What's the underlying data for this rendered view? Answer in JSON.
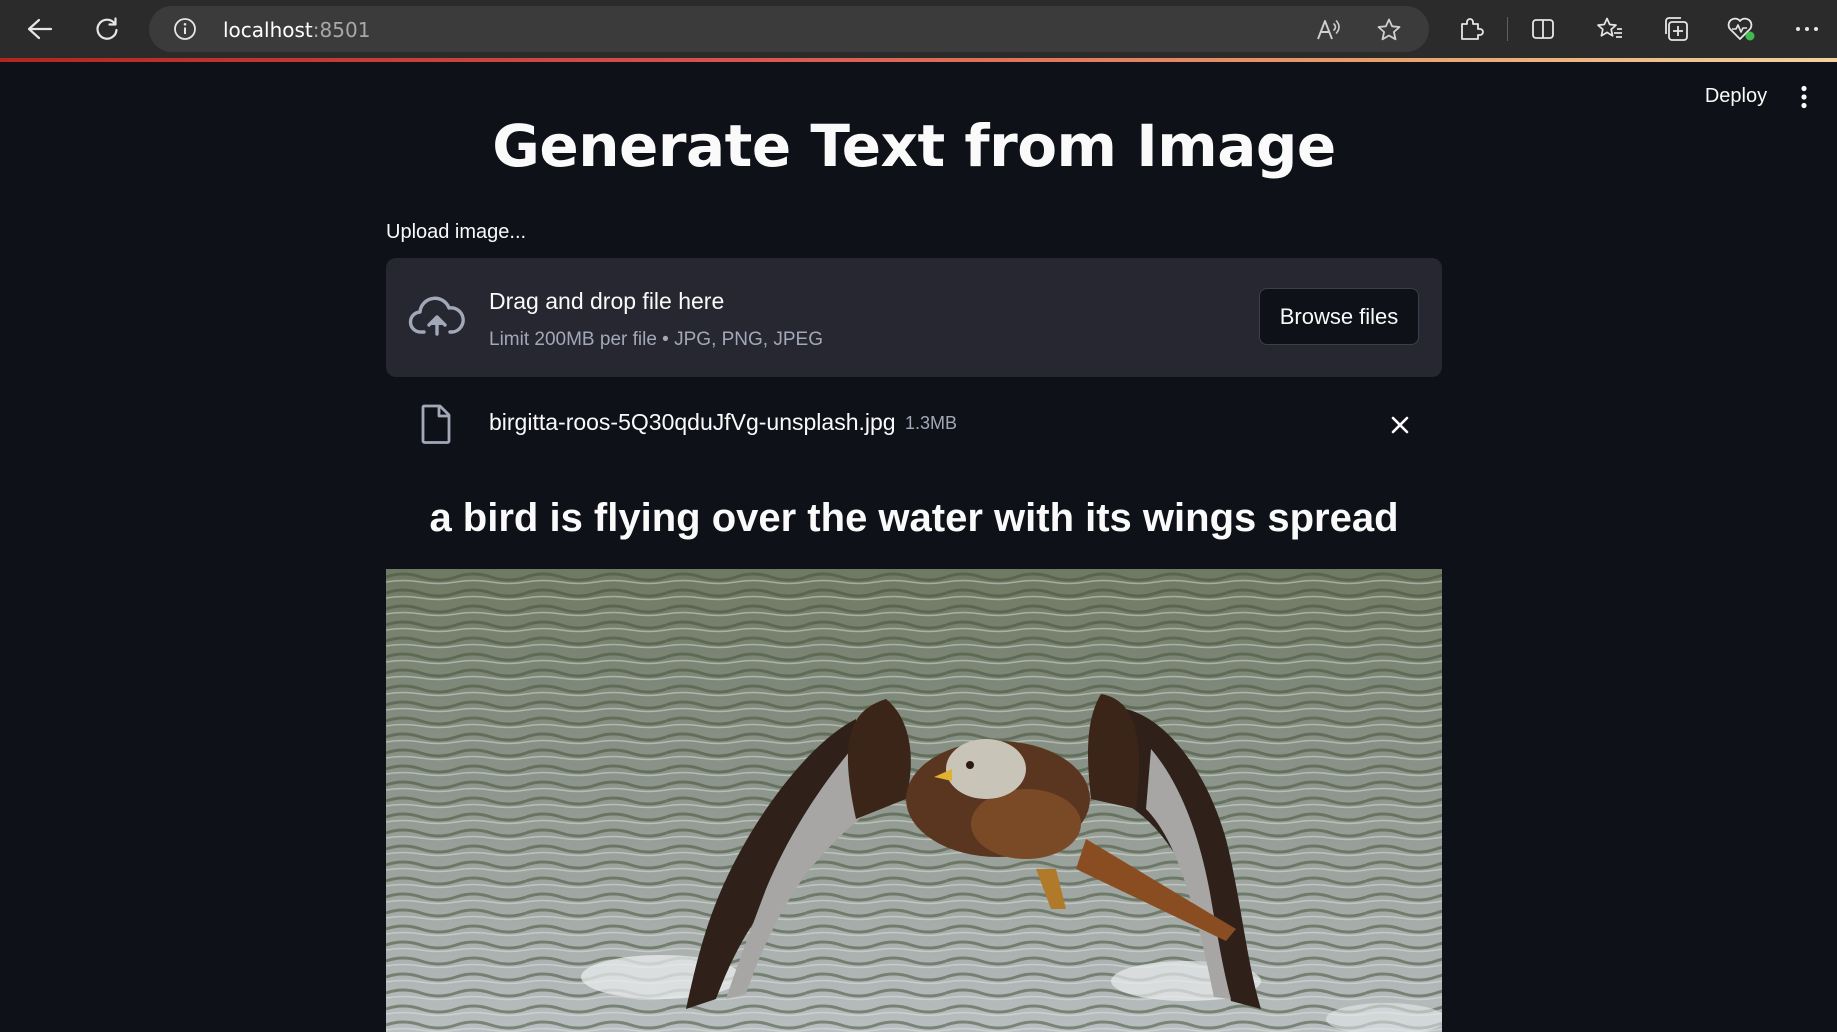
{
  "browser": {
    "url_host": "localhost",
    "url_port": ":8501",
    "icons": [
      "back-arrow-icon",
      "refresh-icon",
      "info-icon",
      "read-aloud-icon",
      "favorite-star-icon",
      "extensions-icon",
      "split-screen-icon",
      "favorites-icon",
      "collections-icon",
      "browser-essentials-icon",
      "more-icon"
    ]
  },
  "app": {
    "deploy_label": "Deploy",
    "title": "Generate Text from Image",
    "uploader": {
      "label": "Upload image...",
      "drop_title": "Drag and drop file here",
      "limit_text": "Limit 200MB per file • JPG, PNG, JPEG",
      "browse_label": "Browse files"
    },
    "file": {
      "name": "birgitta-roos-5Q30qduJfVg-unsplash.jpg",
      "size": "1.3MB"
    },
    "caption": "a bird is flying over the water with its wings spread",
    "image_subject": "red kite flying low over rippled water with wings spread"
  },
  "colors": {
    "background": "#0e1117",
    "dropzone": "#262730",
    "text": "#fafafa",
    "muted_text": "#a3a8b8",
    "browser_bar": "#2b2b2b"
  }
}
